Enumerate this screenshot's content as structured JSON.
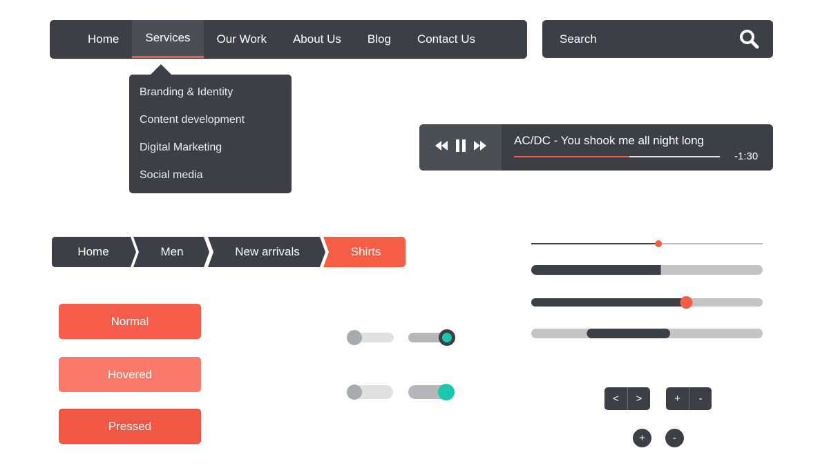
{
  "nav": {
    "items": [
      {
        "label": "Home"
      },
      {
        "label": "Services"
      },
      {
        "label": "Our Work"
      },
      {
        "label": "About Us"
      },
      {
        "label": "Blog"
      },
      {
        "label": "Contact Us"
      }
    ],
    "active": "Services",
    "dropdown": [
      {
        "label": "Branding & Identity"
      },
      {
        "label": "Content development"
      },
      {
        "label": "Digital Marketing"
      },
      {
        "label": "Social media"
      }
    ]
  },
  "search": {
    "placeholder": "Search",
    "icon": "search-icon"
  },
  "player": {
    "track": "AC/DC - You shook me all night long",
    "time_remaining": "-1:30",
    "progress": 0.56,
    "icons": [
      "rewind-icon",
      "pause-icon",
      "fast-forward-icon"
    ]
  },
  "breadcrumb": {
    "items": [
      {
        "label": "Home"
      },
      {
        "label": "Men"
      },
      {
        "label": "New arrivals"
      },
      {
        "label": "Shirts"
      }
    ],
    "active": "Shirts"
  },
  "buttons": {
    "normal": "Normal",
    "hovered": "Hovered",
    "pressed": "Pressed"
  },
  "toggles": [
    {
      "state": "off"
    },
    {
      "state": "on"
    },
    {
      "state": "off"
    },
    {
      "state": "on"
    }
  ],
  "sliders": [
    {
      "value": 0.55
    },
    {
      "value": 0.56
    },
    {
      "value": 0.67
    },
    {
      "range": [
        0.24,
        0.6
      ]
    }
  ],
  "controls": {
    "prev": "<",
    "next": ">",
    "plus": "+",
    "minus": "-"
  },
  "colors": {
    "dark": "#3d3f46",
    "accent": "#f65d45",
    "teal": "#1bc7ad",
    "light_track": "#dddddd"
  }
}
